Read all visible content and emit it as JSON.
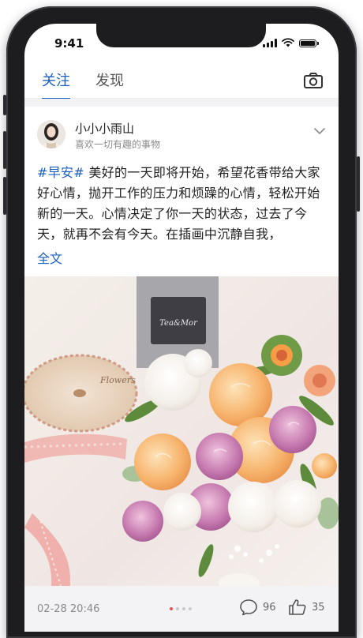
{
  "status_bar": {
    "time": "9:41"
  },
  "tabs": [
    {
      "label": "关注",
      "active": true
    },
    {
      "label": "发现",
      "active": false
    }
  ],
  "post": {
    "username": "小小小雨山",
    "bio": "喜欢一切有趣的事物",
    "hashtag": "#早安#",
    "text": " 美好的一天即将开始，希望花香带给大家好心情，抛开工作的压力和烦躁的心情，轻松开始新的一天。心情决定了你一天的状态，过去了今天，就再不会有今天。在插画中沉静自我，",
    "read_more": "全文",
    "image_labels": {
      "bottle_label": "Tea&Mor",
      "spool_label": "Flowers"
    },
    "date": "02-28 20:46",
    "comments": "96",
    "likes": "35",
    "image_pages": 4,
    "current_image": 1
  },
  "colors": {
    "accent": "#1a5fc2",
    "dot_active": "#e25454"
  },
  "icons": [
    "camera-icon",
    "chevron-down-icon",
    "comment-icon",
    "like-icon",
    "signal-icon",
    "wifi-icon",
    "battery-icon"
  ]
}
